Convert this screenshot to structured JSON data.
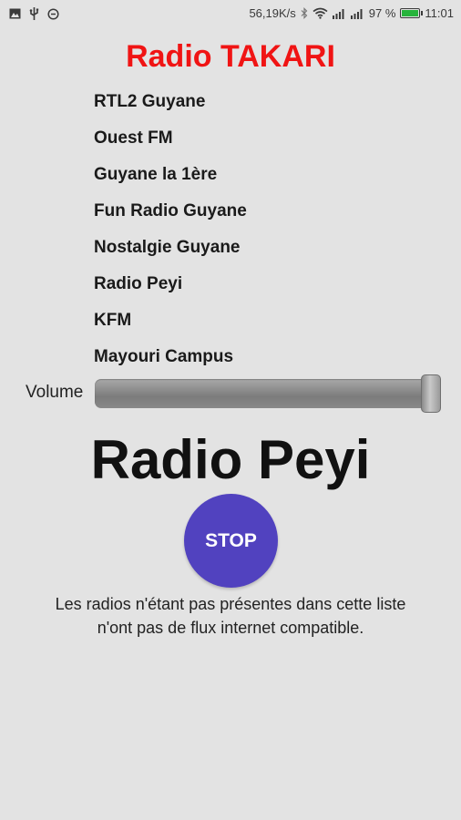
{
  "status_bar": {
    "left_icons": [
      "image-icon",
      "usb-icon",
      "sync-icon"
    ],
    "network_speed": "56,19K/s",
    "right_icons": [
      "bluetooth-icon",
      "wifi-icon",
      "signal-icon-1",
      "signal-icon-2"
    ],
    "battery_percent": "97 %",
    "battery_level": 0.97,
    "time": "11:01"
  },
  "app": {
    "title": "Radio TAKARI",
    "title_color": "#f01414"
  },
  "stations": [
    {
      "label": "RTL2 Guyane"
    },
    {
      "label": "Ouest FM"
    },
    {
      "label": "Guyane la 1ère"
    },
    {
      "label": "Fun Radio Guyane"
    },
    {
      "label": "Nostalgie Guyane"
    },
    {
      "label": "Radio Peyi"
    },
    {
      "label": "KFM"
    },
    {
      "label": "Mayouri Campus"
    }
  ],
  "volume": {
    "label": "Volume",
    "level": 1.0
  },
  "player": {
    "now_playing": "Radio Peyi",
    "stop_label": "STOP",
    "stop_color": "#5142bf"
  },
  "footnote": {
    "line1": "Les radios n'étant pas présentes dans cette liste",
    "line2": "n'ont pas de flux internet compatible."
  }
}
